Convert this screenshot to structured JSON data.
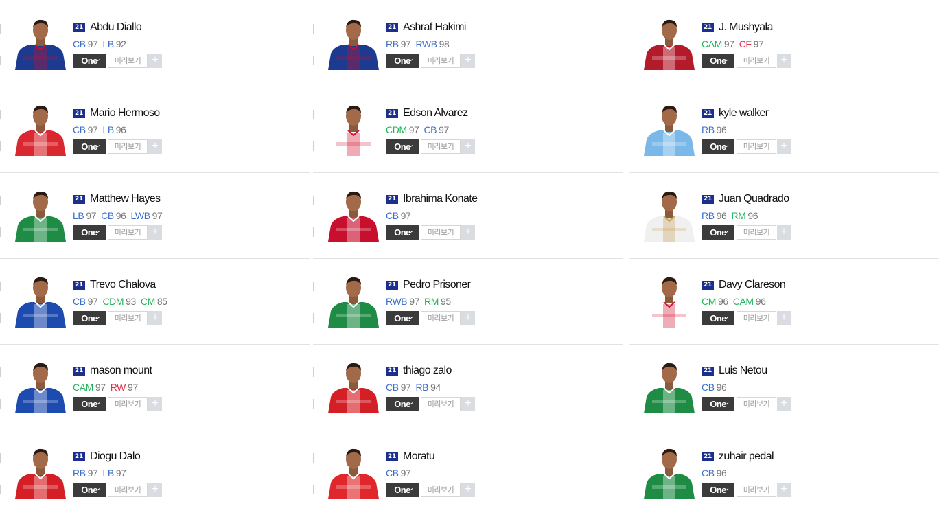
{
  "colors": {
    "cb": "#3b6fcc",
    "green": "#1fb45b",
    "red": "#e0334b",
    "season_badge": "#1b2f8c"
  },
  "labels": {
    "one_button": "One",
    "preview_button": "미리보기",
    "add_icon": "+"
  },
  "players": [
    {
      "season": "21",
      "name": "Abdu Diallo",
      "positions": [
        {
          "pos": "CB",
          "ovr": "97",
          "tone": "cb"
        },
        {
          "pos": "LB",
          "ovr": "92",
          "tone": "cb"
        }
      ],
      "shirt": "#1c3a8f",
      "accent": "#c8102e"
    },
    {
      "season": "21",
      "name": "Ashraf Hakimi",
      "positions": [
        {
          "pos": "RB",
          "ovr": "97",
          "tone": "cb"
        },
        {
          "pos": "RWB",
          "ovr": "98",
          "tone": "cb"
        }
      ],
      "shirt": "#1c3a8f",
      "accent": "#c8102e"
    },
    {
      "season": "21",
      "name": "J. Mushyala",
      "positions": [
        {
          "pos": "CAM",
          "ovr": "97",
          "tone": "green"
        },
        {
          "pos": "CF",
          "ovr": "97",
          "tone": "red"
        }
      ],
      "shirt": "#b31b2b",
      "accent": "#ffffff"
    },
    {
      "season": "21",
      "name": "Mario Hermoso",
      "positions": [
        {
          "pos": "CB",
          "ovr": "97",
          "tone": "cb"
        },
        {
          "pos": "LB",
          "ovr": "96",
          "tone": "cb"
        }
      ],
      "shirt": "#d9282f",
      "accent": "#ffffff"
    },
    {
      "season": "21",
      "name": "Edson Alvarez",
      "positions": [
        {
          "pos": "CDM",
          "ovr": "97",
          "tone": "green"
        },
        {
          "pos": "CB",
          "ovr": "97",
          "tone": "cb"
        }
      ],
      "shirt": "#ffffff",
      "accent": "#d2122e"
    },
    {
      "season": "21",
      "name": "kyle walker",
      "positions": [
        {
          "pos": "RB",
          "ovr": "96",
          "tone": "cb"
        }
      ],
      "shirt": "#79b8e8",
      "accent": "#ffffff"
    },
    {
      "season": "21",
      "name": "Matthew Hayes",
      "positions": [
        {
          "pos": "LB",
          "ovr": "97",
          "tone": "cb"
        },
        {
          "pos": "CB",
          "ovr": "96",
          "tone": "cb"
        },
        {
          "pos": "LWB",
          "ovr": "97",
          "tone": "cb"
        }
      ],
      "shirt": "#1e8c45",
      "accent": "#ffffff"
    },
    {
      "season": "21",
      "name": "Ibrahima Konate",
      "positions": [
        {
          "pos": "CB",
          "ovr": "97",
          "tone": "cb"
        }
      ],
      "shirt": "#c8102e",
      "accent": "#ffffff"
    },
    {
      "season": "21",
      "name": "Juan Quadrado",
      "positions": [
        {
          "pos": "RB",
          "ovr": "96",
          "tone": "cb"
        },
        {
          "pos": "RM",
          "ovr": "96",
          "tone": "green"
        }
      ],
      "shirt": "#f0f0f0",
      "accent": "#c9a35a"
    },
    {
      "season": "21",
      "name": "Trevo Chalova",
      "positions": [
        {
          "pos": "CB",
          "ovr": "97",
          "tone": "cb"
        },
        {
          "pos": "CDM",
          "ovr": "93",
          "tone": "green"
        },
        {
          "pos": "CM",
          "ovr": "85",
          "tone": "green"
        }
      ],
      "shirt": "#1d4bb0",
      "accent": "#ffffff"
    },
    {
      "season": "21",
      "name": "Pedro Prisoner",
      "positions": [
        {
          "pos": "RWB",
          "ovr": "97",
          "tone": "cb"
        },
        {
          "pos": "RM",
          "ovr": "95",
          "tone": "green"
        }
      ],
      "shirt": "#1e8c45",
      "accent": "#ffffff"
    },
    {
      "season": "21",
      "name": "Davy Clareson",
      "positions": [
        {
          "pos": "CM",
          "ovr": "96",
          "tone": "green"
        },
        {
          "pos": "CAM",
          "ovr": "96",
          "tone": "green"
        }
      ],
      "shirt": "#ffffff",
      "accent": "#d2122e"
    },
    {
      "season": "21",
      "name": "mason mount",
      "positions": [
        {
          "pos": "CAM",
          "ovr": "97",
          "tone": "green"
        },
        {
          "pos": "RW",
          "ovr": "97",
          "tone": "red"
        }
      ],
      "shirt": "#1d4bb0",
      "accent": "#ffffff"
    },
    {
      "season": "21",
      "name": "thiago zalo",
      "positions": [
        {
          "pos": "CB",
          "ovr": "97",
          "tone": "cb"
        },
        {
          "pos": "RB",
          "ovr": "94",
          "tone": "cb"
        }
      ],
      "shirt": "#d41f26",
      "accent": "#ffffff"
    },
    {
      "season": "21",
      "name": "Luis Netou",
      "positions": [
        {
          "pos": "CB",
          "ovr": "96",
          "tone": "cb"
        }
      ],
      "shirt": "#1e8c45",
      "accent": "#ffffff"
    },
    {
      "season": "21",
      "name": "Diogu Dalo",
      "positions": [
        {
          "pos": "RB",
          "ovr": "97",
          "tone": "cb"
        },
        {
          "pos": "LB",
          "ovr": "97",
          "tone": "cb"
        }
      ],
      "shirt": "#d41f26",
      "accent": "#ffffff"
    },
    {
      "season": "21",
      "name": "Moratu",
      "positions": [
        {
          "pos": "CB",
          "ovr": "97",
          "tone": "cb"
        }
      ],
      "shirt": "#e0272b",
      "accent": "#ffffff"
    },
    {
      "season": "21",
      "name": "zuhair pedal",
      "positions": [
        {
          "pos": "CB",
          "ovr": "96",
          "tone": "cb"
        }
      ],
      "shirt": "#1e8c45",
      "accent": "#ffffff"
    }
  ]
}
